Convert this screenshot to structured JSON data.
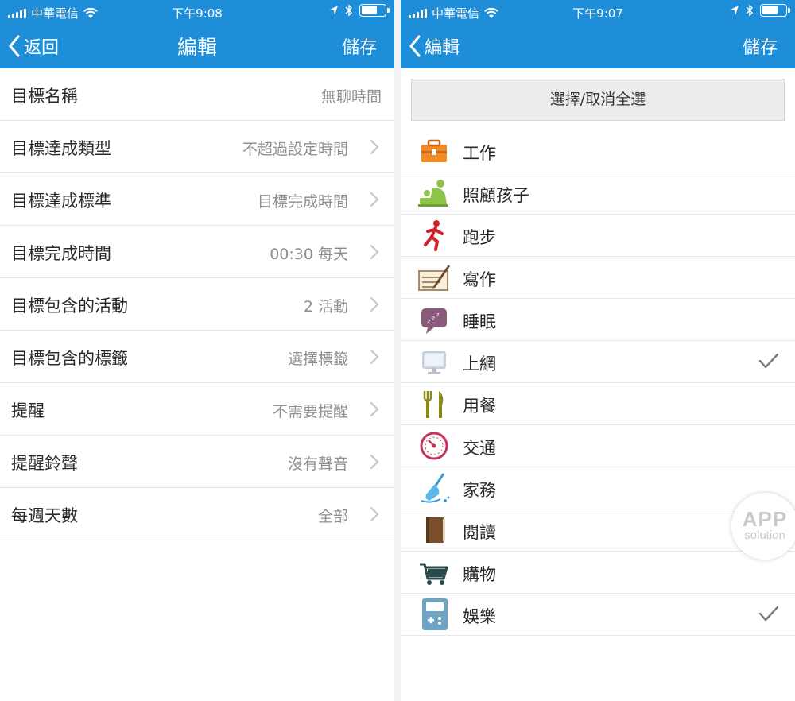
{
  "left": {
    "status": {
      "carrier": "中華電信",
      "time": "下午9:08"
    },
    "nav": {
      "back": "返回",
      "title": "編輯",
      "save": "儲存"
    },
    "rows": [
      {
        "label": "目標名稱",
        "value": "無聊時間",
        "chevron": false
      },
      {
        "label": "目標達成類型",
        "value": "不超過設定時間",
        "chevron": true
      },
      {
        "label": "目標達成標準",
        "value": "目標完成時間",
        "chevron": true
      },
      {
        "label": "目標完成時間",
        "value": "00:30 每天",
        "chevron": true
      },
      {
        "label": "目標包含的活動",
        "value": "2 活動",
        "chevron": true
      },
      {
        "label": "目標包含的標籤",
        "value": "選擇標籤",
        "chevron": true
      },
      {
        "label": "提醒",
        "value": "不需要提醒",
        "chevron": true
      },
      {
        "label": "提醒鈴聲",
        "value": "沒有聲音",
        "chevron": true
      },
      {
        "label": "每週天數",
        "value": "全部",
        "chevron": true
      }
    ]
  },
  "right": {
    "status": {
      "carrier": "中華電信",
      "time": "下午9:07"
    },
    "nav": {
      "back": "編輯",
      "save": "儲存"
    },
    "select_all": "選擇/取消全選",
    "activities": [
      {
        "name": "工作",
        "icon": "toolbox-icon",
        "checked": false
      },
      {
        "name": "照顧孩子",
        "icon": "childcare-icon",
        "checked": false
      },
      {
        "name": "跑步",
        "icon": "runner-icon",
        "checked": false
      },
      {
        "name": "寫作",
        "icon": "writing-icon",
        "checked": false
      },
      {
        "name": "睡眠",
        "icon": "sleep-bubble-icon",
        "checked": false
      },
      {
        "name": "上網",
        "icon": "monitor-icon",
        "checked": true
      },
      {
        "name": "用餐",
        "icon": "fork-knife-icon",
        "checked": false
      },
      {
        "name": "交通",
        "icon": "speedometer-icon",
        "checked": false
      },
      {
        "name": "家務",
        "icon": "broom-icon",
        "checked": false
      },
      {
        "name": "閱讀",
        "icon": "book-icon",
        "checked": false
      },
      {
        "name": "購物",
        "icon": "cart-icon",
        "checked": false
      },
      {
        "name": "娛樂",
        "icon": "game-device-icon",
        "checked": true
      }
    ]
  },
  "watermark": {
    "line1": "APP",
    "line2": "solution"
  },
  "colors": {
    "nav_blue": "#1e8ed8",
    "value_gray": "#8e8e93",
    "divider": "#e4e4e8"
  }
}
